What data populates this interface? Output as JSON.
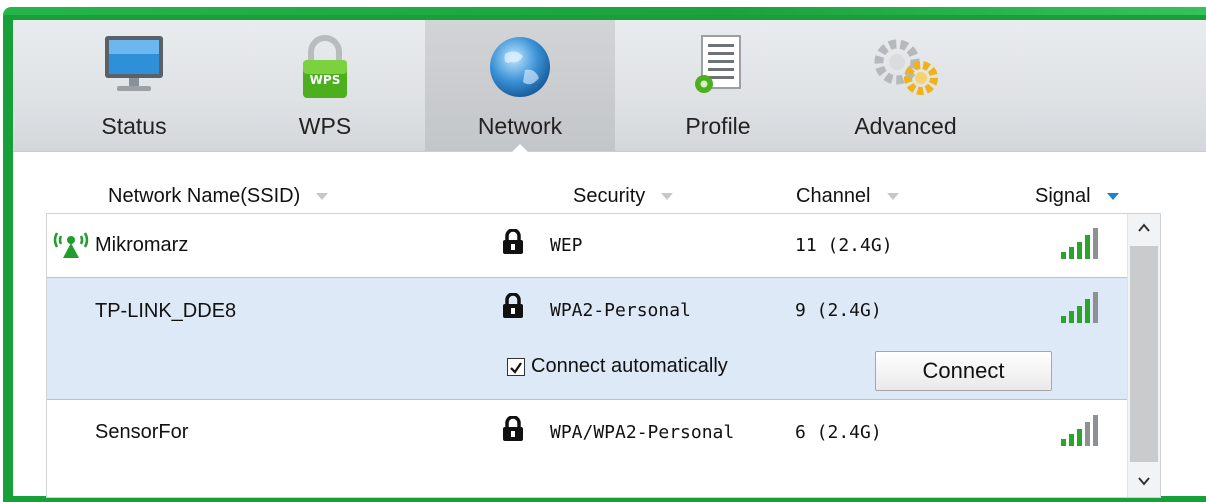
{
  "toolbar": {
    "tabs": [
      {
        "label": "Status",
        "icon": "monitor-icon"
      },
      {
        "label": "WPS",
        "icon": "wps-lock-icon"
      },
      {
        "label": "Network",
        "icon": "globe-icon"
      },
      {
        "label": "Profile",
        "icon": "profile-document-icon"
      },
      {
        "label": "Advanced",
        "icon": "gears-icon"
      }
    ],
    "active_tab": "Network"
  },
  "columns": {
    "ssid": "Network Name(SSID)",
    "security": "Security",
    "channel": "Channel",
    "signal": "Signal",
    "sorted_by": "Signal"
  },
  "networks": [
    {
      "ssid": "Mikromarz",
      "security": "WEP",
      "channel": "11 (2.4G)",
      "connected": true,
      "signal_bars": 5
    },
    {
      "ssid": "TP-LINK_DDE8",
      "security": "WPA2-Personal",
      "channel": "9 (2.4G)",
      "selected": true,
      "signal_bars": 5
    },
    {
      "ssid": "SensorFor",
      "security": "WPA/WPA2-Personal",
      "channel": "6 (2.4G)",
      "signal_bars": 5
    }
  ],
  "selected_row": {
    "auto_connect_label": "Connect automatically",
    "auto_connect_checked": true,
    "connect_button": "Connect"
  },
  "colors": {
    "frame_green": "#17a03a",
    "selected_row": "#dde9f6",
    "signal_green": "#2aa52a",
    "sort_active": "#1e7fd6"
  }
}
